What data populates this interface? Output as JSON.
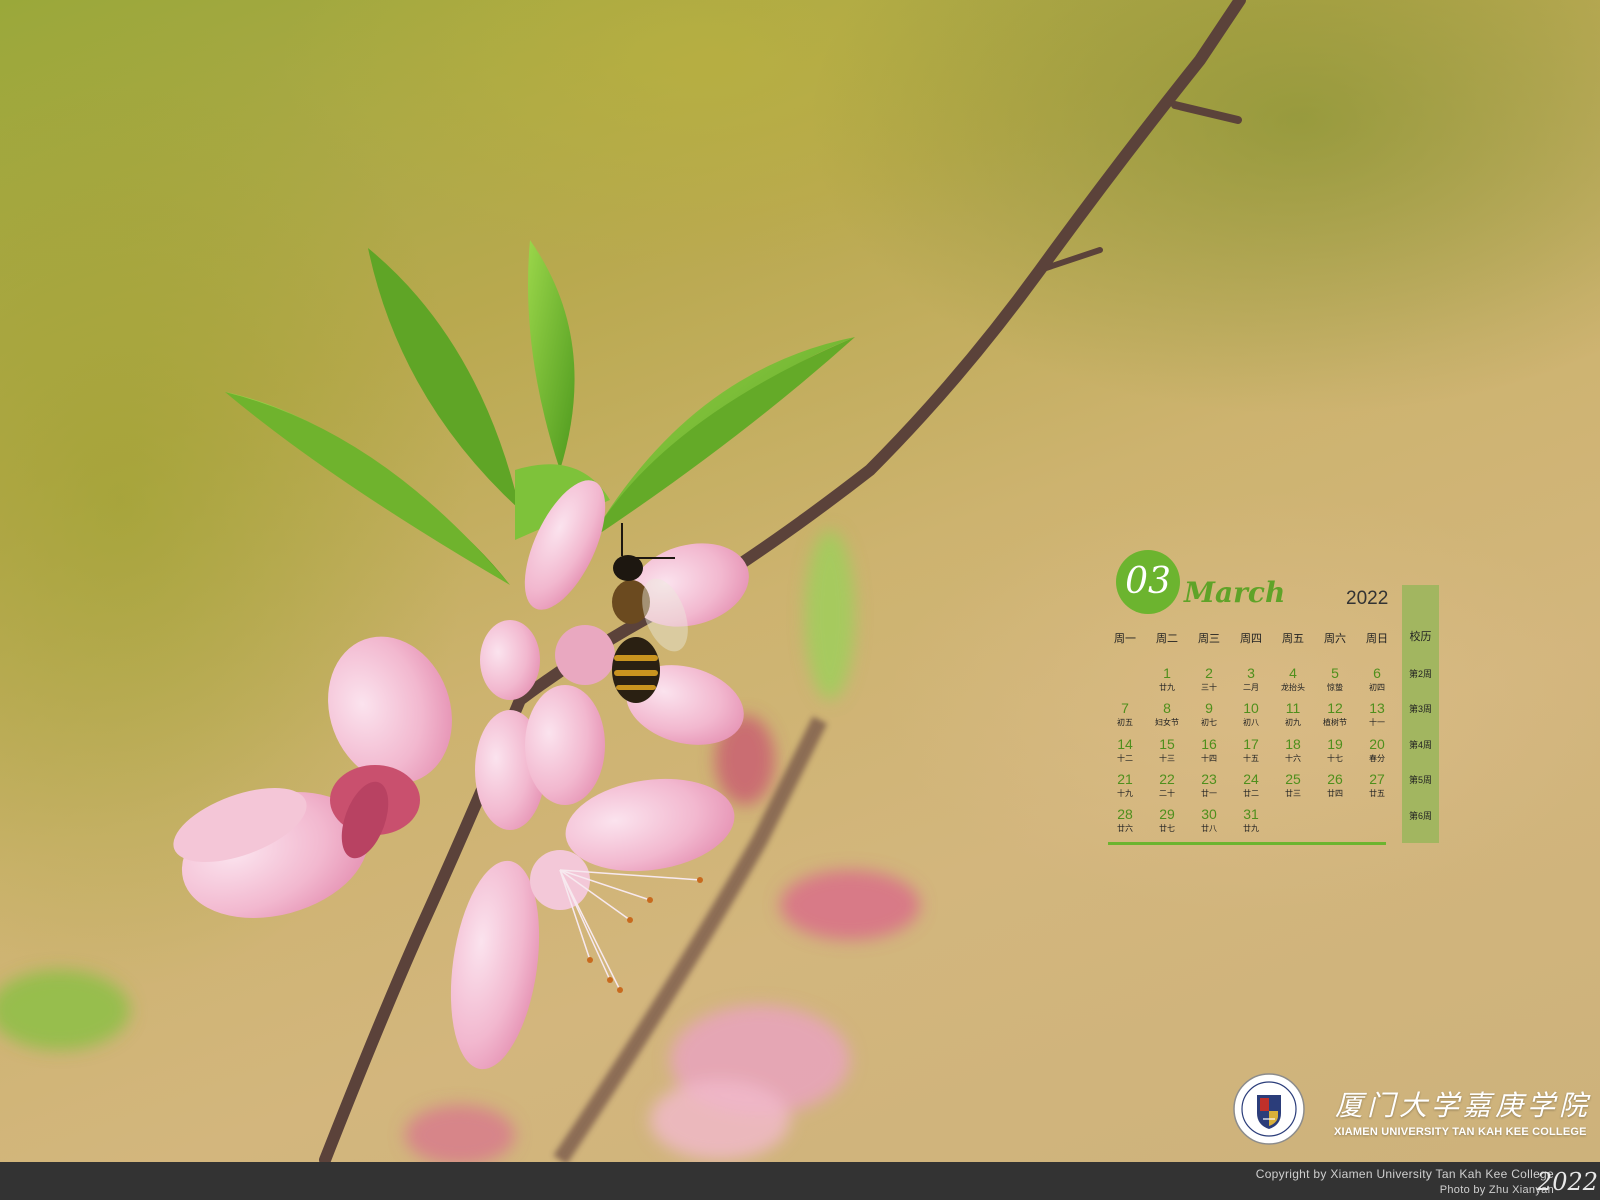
{
  "calendar": {
    "month_number": "03",
    "month_name": "March",
    "year": "2022",
    "weekday_headers": [
      "周一",
      "周二",
      "周三",
      "周四",
      "周五",
      "周六",
      "周日"
    ],
    "school_header": "校历",
    "school_weeks": [
      "第2周",
      "第3周",
      "第4周",
      "第5周",
      "第6周"
    ],
    "accent_color": "#6cb42f",
    "weeks": [
      [
        null,
        {
          "n": "1",
          "l": "廿九"
        },
        {
          "n": "2",
          "l": "三十"
        },
        {
          "n": "3",
          "l": "二月"
        },
        {
          "n": "4",
          "l": "龙抬头"
        },
        {
          "n": "5",
          "l": "惊蛰"
        },
        {
          "n": "6",
          "l": "初四"
        }
      ],
      [
        {
          "n": "7",
          "l": "初五"
        },
        {
          "n": "8",
          "l": "妇女节"
        },
        {
          "n": "9",
          "l": "初七"
        },
        {
          "n": "10",
          "l": "初八"
        },
        {
          "n": "11",
          "l": "初九"
        },
        {
          "n": "12",
          "l": "植树节"
        },
        {
          "n": "13",
          "l": "十一"
        }
      ],
      [
        {
          "n": "14",
          "l": "十二"
        },
        {
          "n": "15",
          "l": "十三"
        },
        {
          "n": "16",
          "l": "十四"
        },
        {
          "n": "17",
          "l": "十五"
        },
        {
          "n": "18",
          "l": "十六"
        },
        {
          "n": "19",
          "l": "十七"
        },
        {
          "n": "20",
          "l": "春分"
        }
      ],
      [
        {
          "n": "21",
          "l": "十九"
        },
        {
          "n": "22",
          "l": "二十"
        },
        {
          "n": "23",
          "l": "廿一"
        },
        {
          "n": "24",
          "l": "廿二"
        },
        {
          "n": "25",
          "l": "廿三"
        },
        {
          "n": "26",
          "l": "廿四"
        },
        {
          "n": "27",
          "l": "廿五"
        }
      ],
      [
        {
          "n": "28",
          "l": "廿六"
        },
        {
          "n": "29",
          "l": "廿七"
        },
        {
          "n": "30",
          "l": "廿八"
        },
        {
          "n": "31",
          "l": "廿九"
        },
        null,
        null,
        null
      ]
    ]
  },
  "logo": {
    "chinese_name": "厦门大学嘉庚学院",
    "english_name": "XIAMEN UNIVERSITY TAN KAH KEE COLLEGE",
    "emblem_icon": "college-emblem-icon"
  },
  "footer": {
    "copyright": "Copyright by Xiamen University Tan Kah Kee College",
    "photo_credit": "Photo by  Zhu Xianyan",
    "year": "2022"
  }
}
